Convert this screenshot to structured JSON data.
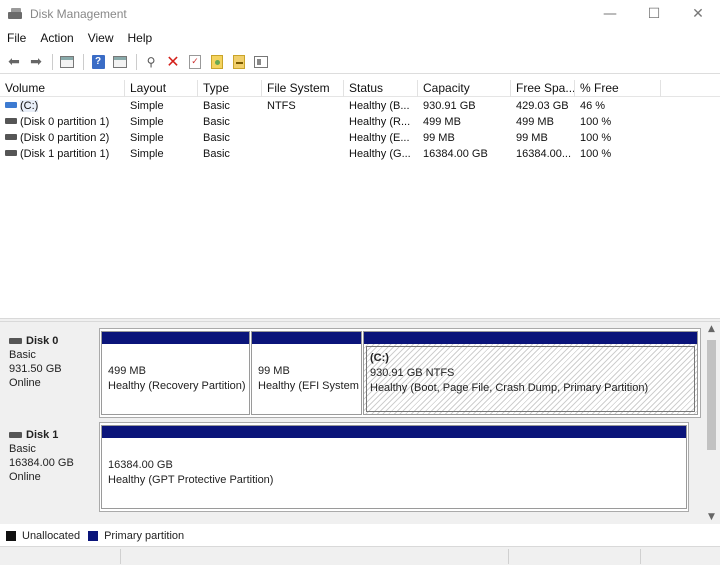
{
  "window": {
    "title": "Disk Management",
    "minimize": "—",
    "maximize": "☐",
    "close": "✕"
  },
  "menu": [
    "File",
    "Action",
    "View",
    "Help"
  ],
  "toolbar": {
    "icons": [
      "back-icon",
      "forward-icon",
      "console-tree-icon",
      "help-icon",
      "details-pane-icon",
      "connect-key-icon",
      "delete-icon",
      "checklist-icon",
      "new-document-icon",
      "import-document-icon",
      "properties-icon"
    ]
  },
  "volume_list": {
    "columns": [
      "Volume",
      "Layout",
      "Type",
      "File System",
      "Status",
      "Capacity",
      "Free Spa...",
      "% Free"
    ],
    "rows": [
      [
        "(C:)",
        "Simple",
        "Basic",
        "NTFS",
        "Healthy (B...",
        "930.91 GB",
        "429.03 GB",
        "46 %"
      ],
      [
        "(Disk 0 partition 1)",
        "Simple",
        "Basic",
        "",
        "Healthy (R...",
        "499 MB",
        "499 MB",
        "100 %"
      ],
      [
        "(Disk 0 partition 2)",
        "Simple",
        "Basic",
        "",
        "Healthy (E...",
        "99 MB",
        "99 MB",
        "100 %"
      ],
      [
        "(Disk 1 partition 1)",
        "Simple",
        "Basic",
        "",
        "Healthy (G...",
        "16384.00 GB",
        "16384.00...",
        "100 %"
      ]
    ]
  },
  "disks": [
    {
      "name": "Disk 0",
      "type": "Basic",
      "size": "931.50 GB",
      "state": "Online",
      "partitions": [
        {
          "label": "",
          "size": "499 MB",
          "status": "Healthy (Recovery Partition)"
        },
        {
          "label": "",
          "size": "99 MB",
          "status": "Healthy (EFI System Partition)"
        },
        {
          "label": "(C:)",
          "size": "930.91 GB NTFS",
          "status": "Healthy (Boot, Page File, Crash Dump, Primary Partition)"
        }
      ]
    },
    {
      "name": "Disk 1",
      "type": "Basic",
      "size": "16384.00 GB",
      "state": "Online",
      "partitions": [
        {
          "label": "",
          "size": "16384.00 GB",
          "status": "Healthy (GPT Protective Partition)"
        }
      ]
    }
  ],
  "scrollbar": {
    "up": "▲",
    "down": "▼"
  },
  "legend": [
    {
      "label": "Unallocated",
      "color": "#111111"
    },
    {
      "label": "Primary partition",
      "color": "#0a147a"
    }
  ]
}
